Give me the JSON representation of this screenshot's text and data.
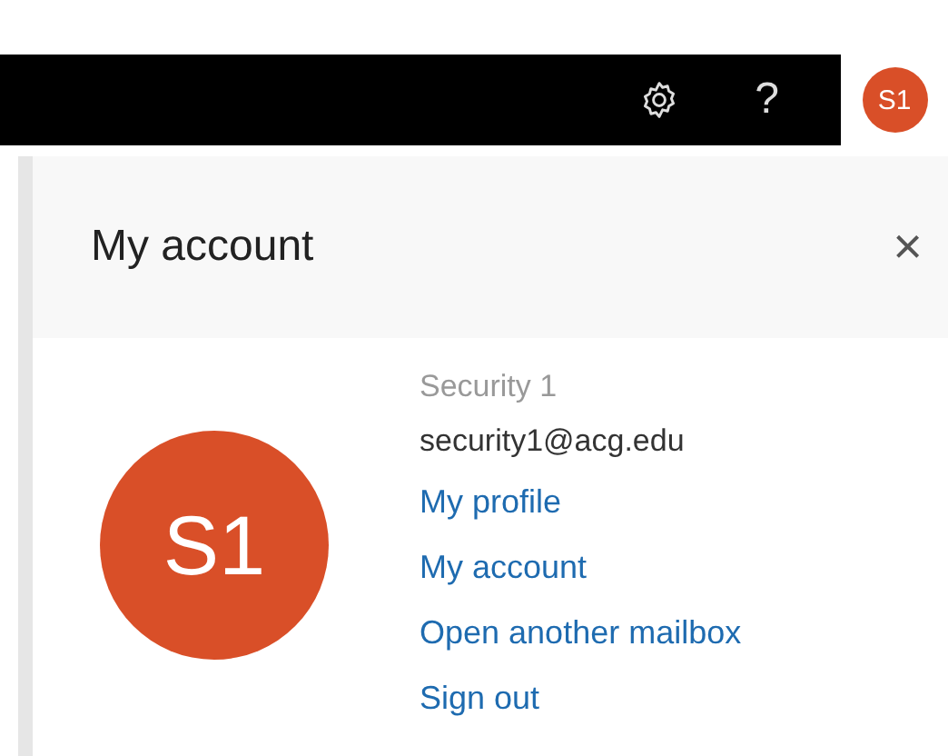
{
  "top_bar": {
    "help": "?",
    "avatar_initials": "S1"
  },
  "panel": {
    "title": "My account",
    "close": "×",
    "avatar_initials": "S1",
    "name": "Security 1",
    "email": "security1@acg.edu",
    "links": [
      "My profile",
      "My account",
      "Open another mailbox",
      "Sign out"
    ]
  }
}
